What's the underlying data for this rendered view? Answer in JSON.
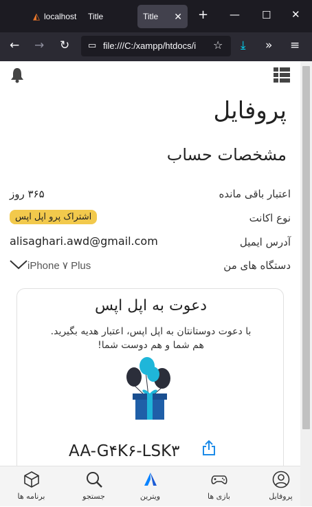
{
  "browser": {
    "tabs": [
      {
        "label": "localhost"
      },
      {
        "label": "Title"
      },
      {
        "label": "Title"
      }
    ],
    "url": "file:///C:/xampp/htdocs/i"
  },
  "page": {
    "title": "پروفایل",
    "subtitle": "مشخصات حساب",
    "rows": [
      {
        "label": "اعتبار باقی مانده",
        "value": "۳۶۵ روز"
      },
      {
        "label": "نوع اکانت",
        "value": "اشتراک پرو اپل اپس"
      },
      {
        "label": "آدرس ایمیل",
        "value": "alisaghari.awd@gmail.com"
      },
      {
        "label": "دستگاه های من",
        "value": "iPhone ۷ Plus"
      }
    ],
    "invite": {
      "title": "دعوت به اپل اپس",
      "text_line1": "با دعوت دوستانتان به اپل اپس، اعتبار هدیه بگیرید.",
      "text_line2": "هم شما و هم دوست شما!",
      "code": "AA-G۴K۶-LSK۳"
    }
  },
  "bottom_nav": [
    {
      "label": "پروفایل",
      "icon": "user-circle-icon"
    },
    {
      "label": "بازی ها",
      "icon": "gamepad-icon"
    },
    {
      "label": "ویترین",
      "icon": "showcase-logo-icon"
    },
    {
      "label": "جستجو",
      "icon": "search-icon"
    },
    {
      "label": "برنامه ها",
      "icon": "cube-icon"
    }
  ],
  "colors": {
    "accent": "#0a84ff",
    "badge": "#f2c94c",
    "balloon_cyan": "#1fb6d9",
    "balloon_dark": "#2b2e3a",
    "gift_blue": "#1f5fa8"
  }
}
